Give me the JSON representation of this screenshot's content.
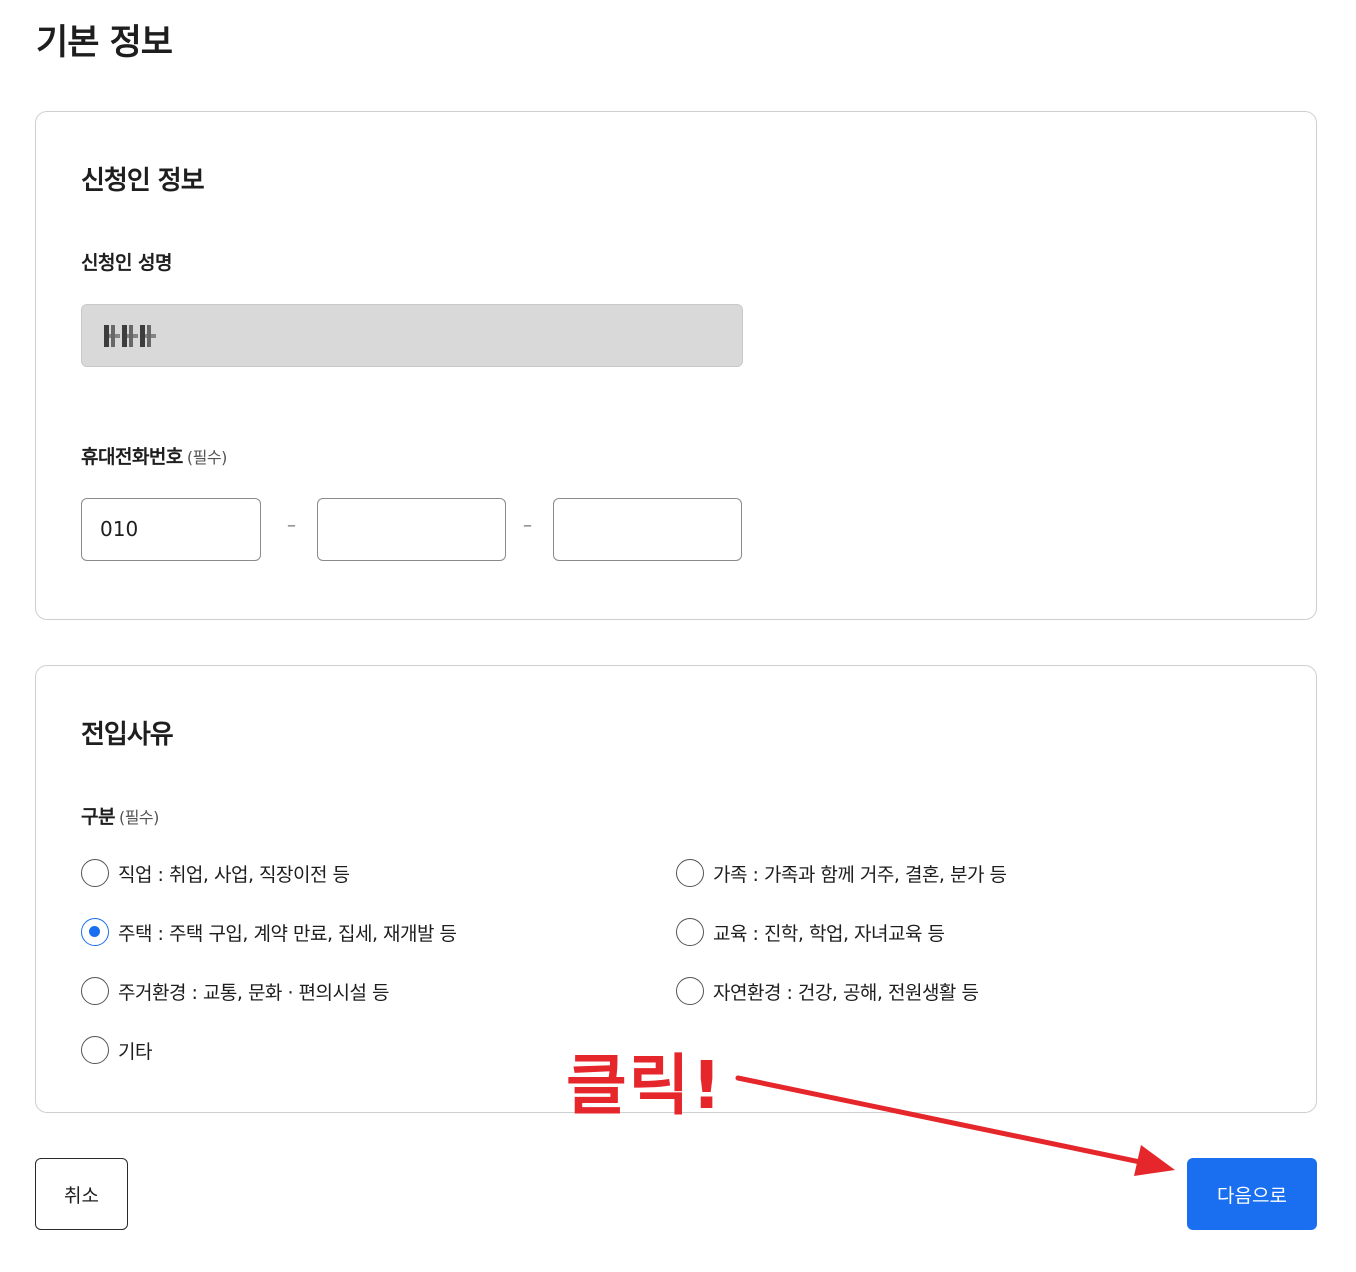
{
  "page": {
    "title": "기본 정보"
  },
  "applicant": {
    "section_title": "신청인 정보",
    "name_label": "신청인 성명",
    "phone_label": "휴대전화번호",
    "phone_required": "(필수)",
    "phone_1": "010",
    "phone_2": "",
    "phone_3": "",
    "phone_separator": "–"
  },
  "reason": {
    "section_title": "전입사유",
    "category_label": "구분",
    "category_required": "(필수)",
    "options": [
      {
        "label": "직업 : 취업, 사업, 직장이전 등",
        "checked": false
      },
      {
        "label": "가족 : 가족과 함께 거주, 결혼, 분가 등",
        "checked": false
      },
      {
        "label": "주택 : 주택 구입, 계약 만료, 집세, 재개발 등",
        "checked": true
      },
      {
        "label": "교육 : 진학, 학업, 자녀교육 등",
        "checked": false
      },
      {
        "label": "주거환경 : 교통, 문화 · 편의시설 등",
        "checked": false
      },
      {
        "label": "자연환경 : 건강, 공해, 전원생활 등",
        "checked": false
      },
      {
        "label": "기타",
        "checked": false
      }
    ]
  },
  "buttons": {
    "cancel": "취소",
    "next": "다음으로"
  },
  "annotation": {
    "text": "클릭!",
    "color": "#e5262b"
  },
  "colors": {
    "primary": "#1a6ff0",
    "annotation": "#e5262b"
  }
}
